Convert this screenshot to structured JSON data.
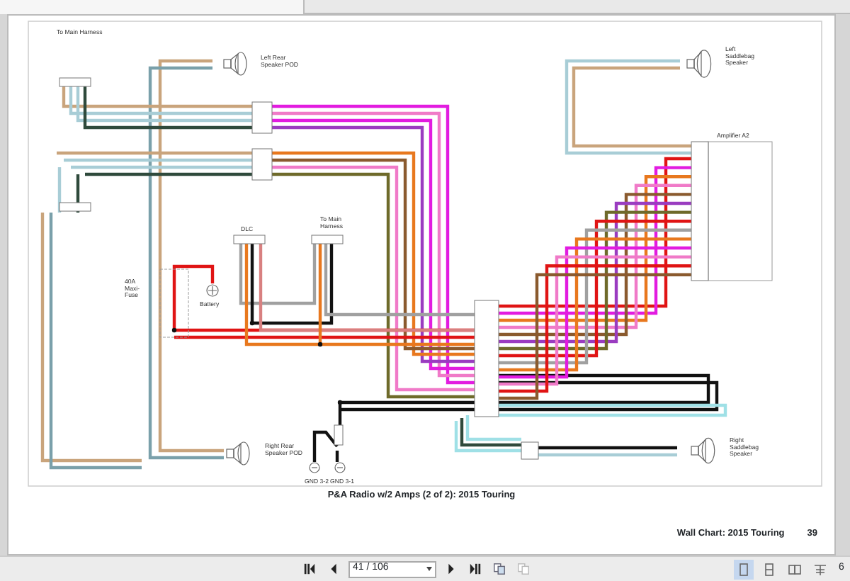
{
  "page": {
    "diagram_labels": [
      {
        "lines": [
          "To Main Harness"
        ]
      },
      {
        "lines": [
          "Left Rear",
          "Speaker POD"
        ]
      },
      {
        "lines": [
          "Left",
          "Saddlebag",
          "Speaker"
        ]
      },
      {
        "lines": [
          "Amplifier A2"
        ]
      },
      {
        "lines": [
          "DLC"
        ]
      },
      {
        "lines": [
          "To Main",
          "Harness"
        ]
      },
      {
        "lines": [
          "40A",
          "Maxi-",
          "Fuse"
        ]
      },
      {
        "lines": [
          "Battery"
        ]
      },
      {
        "lines": [
          "Right Rear",
          "Speaker POD"
        ]
      },
      {
        "lines": [
          "GND 3-2"
        ]
      },
      {
        "lines": [
          "GND 3-1"
        ]
      },
      {
        "lines": [
          "Right",
          "Saddlebag",
          "Speaker"
        ]
      }
    ],
    "caption": "P&A Radio w/2 Amps (2 of 2): 2015 Touring",
    "footer": "Wall Chart:  2015 Touring",
    "page_number": "39"
  },
  "toolbar": {
    "page_field": "41 / 106",
    "zoom_level": "6",
    "view_modes": [
      {
        "kind": "single",
        "selected": true
      },
      {
        "kind": "continuous",
        "selected": false
      },
      {
        "kind": "facing",
        "selected": false
      },
      {
        "kind": "scroll",
        "selected": false
      }
    ]
  }
}
